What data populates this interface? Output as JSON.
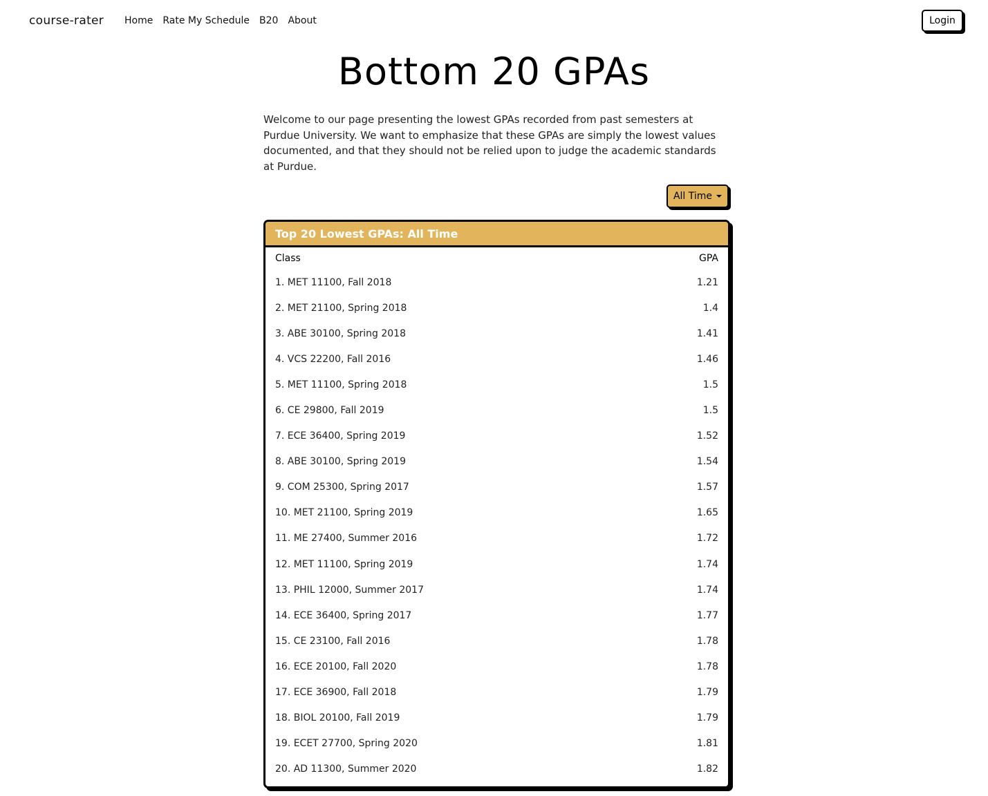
{
  "navbar": {
    "brand": "course-rater",
    "links": [
      "Home",
      "Rate My Schedule",
      "B20",
      "About"
    ],
    "login_label": "Login"
  },
  "page": {
    "title": "Bottom 20 GPAs",
    "intro": "Welcome to our page presenting the lowest GPAs recorded from past semesters at Purdue University. We want to emphasize that these GPAs are simply the lowest values documented, and that they should not be relied upon to judge the academic standards at Purdue."
  },
  "filter": {
    "selected": "All Time"
  },
  "table": {
    "header": "Top 20 Lowest GPAs: All Time",
    "columns": [
      "Class",
      "GPA"
    ],
    "rows": [
      {
        "cls": "1. MET 11100, Fall 2018",
        "gpa": "1.21"
      },
      {
        "cls": "2. MET 21100, Spring 2018",
        "gpa": "1.4"
      },
      {
        "cls": "3. ABE 30100, Spring 2018",
        "gpa": "1.41"
      },
      {
        "cls": "4. VCS 22200, Fall 2016",
        "gpa": "1.46"
      },
      {
        "cls": "5. MET 11100, Spring 2018",
        "gpa": "1.5"
      },
      {
        "cls": "6. CE 29800, Fall 2019",
        "gpa": "1.5"
      },
      {
        "cls": "7. ECE 36400, Spring 2019",
        "gpa": "1.52"
      },
      {
        "cls": "8. ABE 30100, Spring 2019",
        "gpa": "1.54"
      },
      {
        "cls": "9. COM 25300, Spring 2017",
        "gpa": "1.57"
      },
      {
        "cls": "10. MET 21100, Spring 2019",
        "gpa": "1.65"
      },
      {
        "cls": "11. ME 27400, Summer 2016",
        "gpa": "1.72"
      },
      {
        "cls": "12. MET 11100, Spring 2019",
        "gpa": "1.74"
      },
      {
        "cls": "13. PHIL 12000, Summer 2017",
        "gpa": "1.74"
      },
      {
        "cls": "14. ECE 36400, Spring 2017",
        "gpa": "1.77"
      },
      {
        "cls": "15. CE 23100, Fall 2016",
        "gpa": "1.78"
      },
      {
        "cls": "16. ECE 20100, Fall 2020",
        "gpa": "1.78"
      },
      {
        "cls": "17. ECE 36900, Fall 2018",
        "gpa": "1.79"
      },
      {
        "cls": "18. BIOL 20100, Fall 2019",
        "gpa": "1.79"
      },
      {
        "cls": "19. ECET 27700, Spring 2020",
        "gpa": "1.81"
      },
      {
        "cls": "20. AD 11300, Summer 2020",
        "gpa": "1.82"
      }
    ]
  },
  "colors": {
    "accent": "#e2b55c",
    "border": "#000000"
  }
}
